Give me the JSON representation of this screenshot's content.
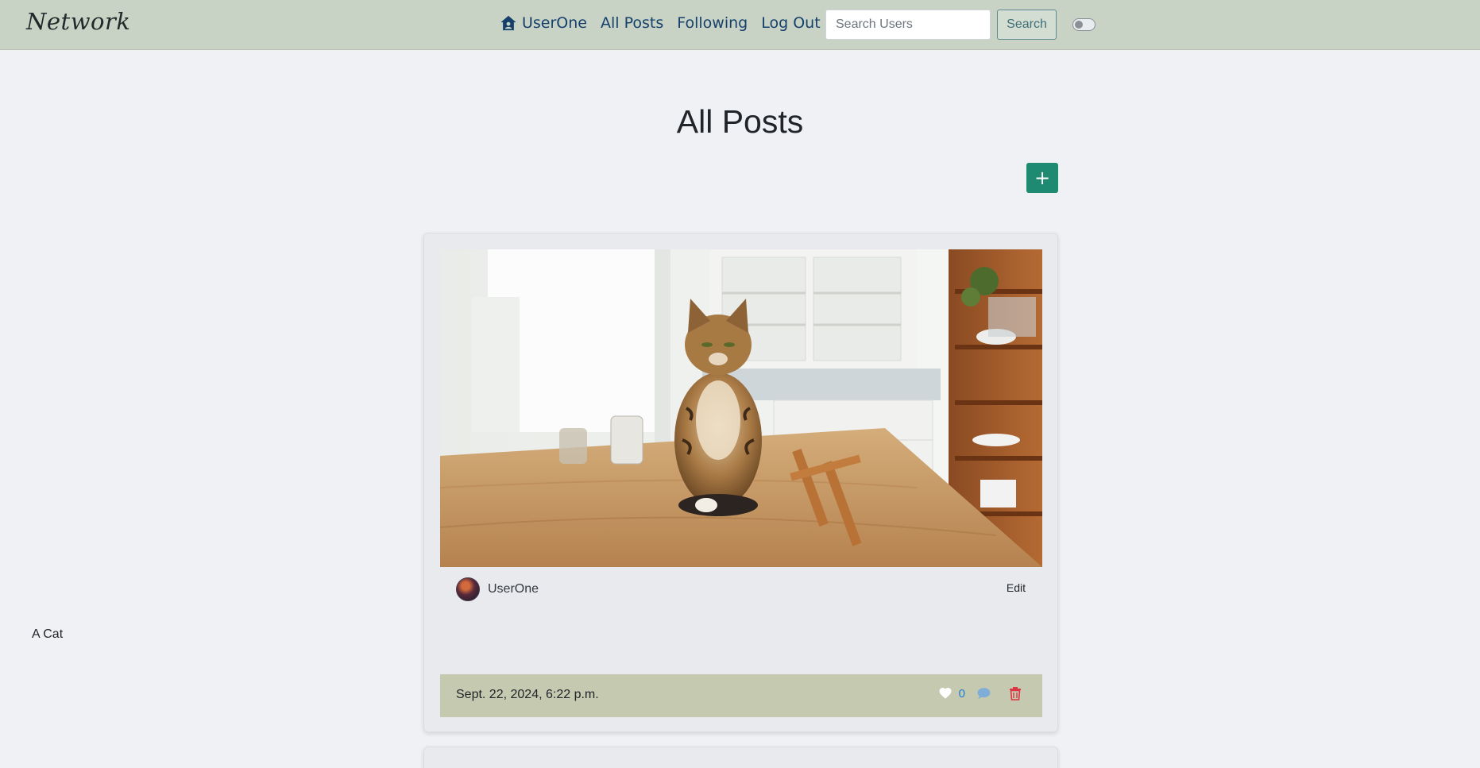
{
  "navbar": {
    "brand": "Network",
    "links": [
      {
        "label": "UserOne",
        "icon": "home-icon"
      },
      {
        "label": "All Posts"
      },
      {
        "label": "Following"
      },
      {
        "label": "Log Out"
      }
    ],
    "search": {
      "placeholder": "Search Users",
      "value": "",
      "button_label": "Search"
    },
    "theme_toggle": {
      "state": "off"
    }
  },
  "main": {
    "title": "All Posts",
    "add_button_label": "+",
    "posts": [
      {
        "author": "UserOne",
        "edit_label": "Edit",
        "content": "A Cat",
        "timestamp": "Sept. 22, 2024, 6:22 p.m.",
        "likes": "0",
        "image_alt": "Cat sitting on kitchen table"
      }
    ]
  },
  "colors": {
    "navbar_bg": "#c9d3c5",
    "nav_link": "#15406b",
    "accent_green": "#1e8a72",
    "footer_bg": "#c4c9b0",
    "like_blue": "#1d7fd6",
    "delete_red": "#dc3545"
  }
}
